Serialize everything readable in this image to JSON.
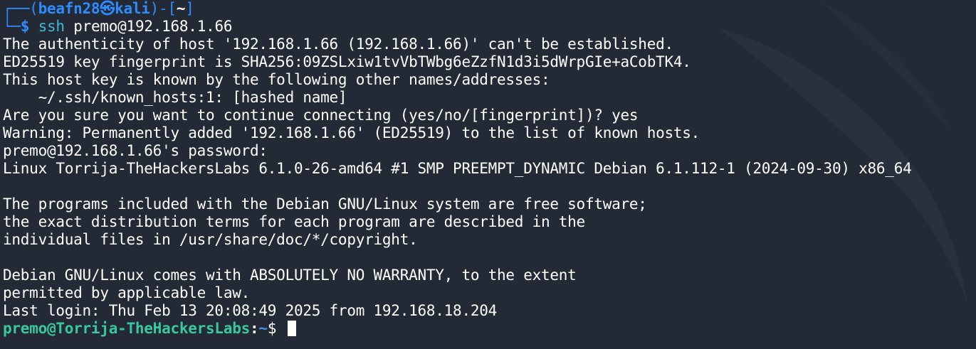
{
  "prompt": {
    "corner_top": "┌──(",
    "user": "beafn28",
    "skull": "㉿",
    "host": "kali",
    "bracket_mid": ")-[",
    "cwd": "~",
    "bracket_end": "]",
    "corner_bottom": "└─",
    "dollar": "$",
    "command": "ssh",
    "args": " premo@192.168.1.66"
  },
  "output_lines": [
    "The authenticity of host '192.168.1.66 (192.168.1.66)' can't be established.",
    "ED25519 key fingerprint is SHA256:09ZSLxiw1tvVbTWbg6eZzfN1d3i5dWrpGIe+aCobTK4.",
    "This host key is known by the following other names/addresses:",
    "    ~/.ssh/known_hosts:1: [hashed name]",
    "Are you sure you want to continue connecting (yes/no/[fingerprint])? yes",
    "Warning: Permanently added '192.168.1.66' (ED25519) to the list of known hosts.",
    "premo@192.168.1.66's password: ",
    "Linux Torrija-TheHackersLabs 6.1.0-26-amd64 #1 SMP PREEMPT_DYNAMIC Debian 6.1.112-1 (2024-09-30) x86_64",
    "",
    "The programs included with the Debian GNU/Linux system are free software;",
    "the exact distribution terms for each program are described in the",
    "individual files in /usr/share/doc/*/copyright.",
    "",
    "Debian GNU/Linux comes with ABSOLUTELY NO WARRANTY, to the extent",
    "permitted by applicable law.",
    "Last login: Thu Feb 13 20:08:49 2025 from 192.168.18.204"
  ],
  "remote_prompt": {
    "user_host": "premo@Torrija-TheHackersLabs",
    "colon": ":",
    "path": "~",
    "dollar": "$ "
  },
  "colors": {
    "background": "#232935",
    "prompt_blue": "#2f8cff",
    "command_cyan": "#3db9d6",
    "remote_user_green": "#38c7a0",
    "remote_path_blue": "#3f92e8"
  }
}
